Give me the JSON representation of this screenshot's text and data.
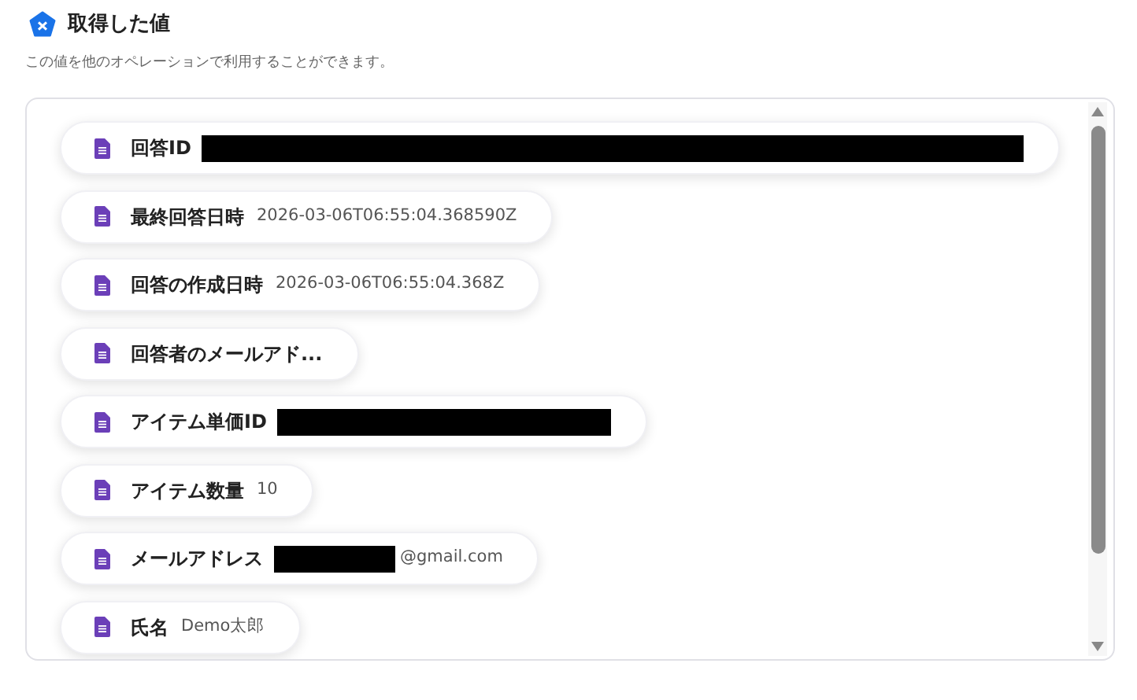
{
  "header": {
    "title": "取得した値",
    "subtitle": "この値を他のオペレーションで利用することができます。"
  },
  "items": [
    {
      "kind": "redacted_long",
      "label": "回答ID"
    },
    {
      "kind": "plain",
      "label": "最終回答日時",
      "value": "2026-03-06T06:55:04.368590Z"
    },
    {
      "kind": "plain",
      "label": "回答の作成日時",
      "value": "2026-03-06T06:55:04.368Z"
    },
    {
      "kind": "plain",
      "label": "回答者のメールアド..."
    },
    {
      "kind": "redacted_medium",
      "label": "アイテム単価ID"
    },
    {
      "kind": "plain",
      "label": "アイテム数量",
      "value": "10"
    },
    {
      "kind": "redacted_short",
      "label": "メールアドレス",
      "value": "@gmail.com"
    },
    {
      "kind": "plain",
      "label": "氏名",
      "value": "Demo太郎"
    }
  ]
}
